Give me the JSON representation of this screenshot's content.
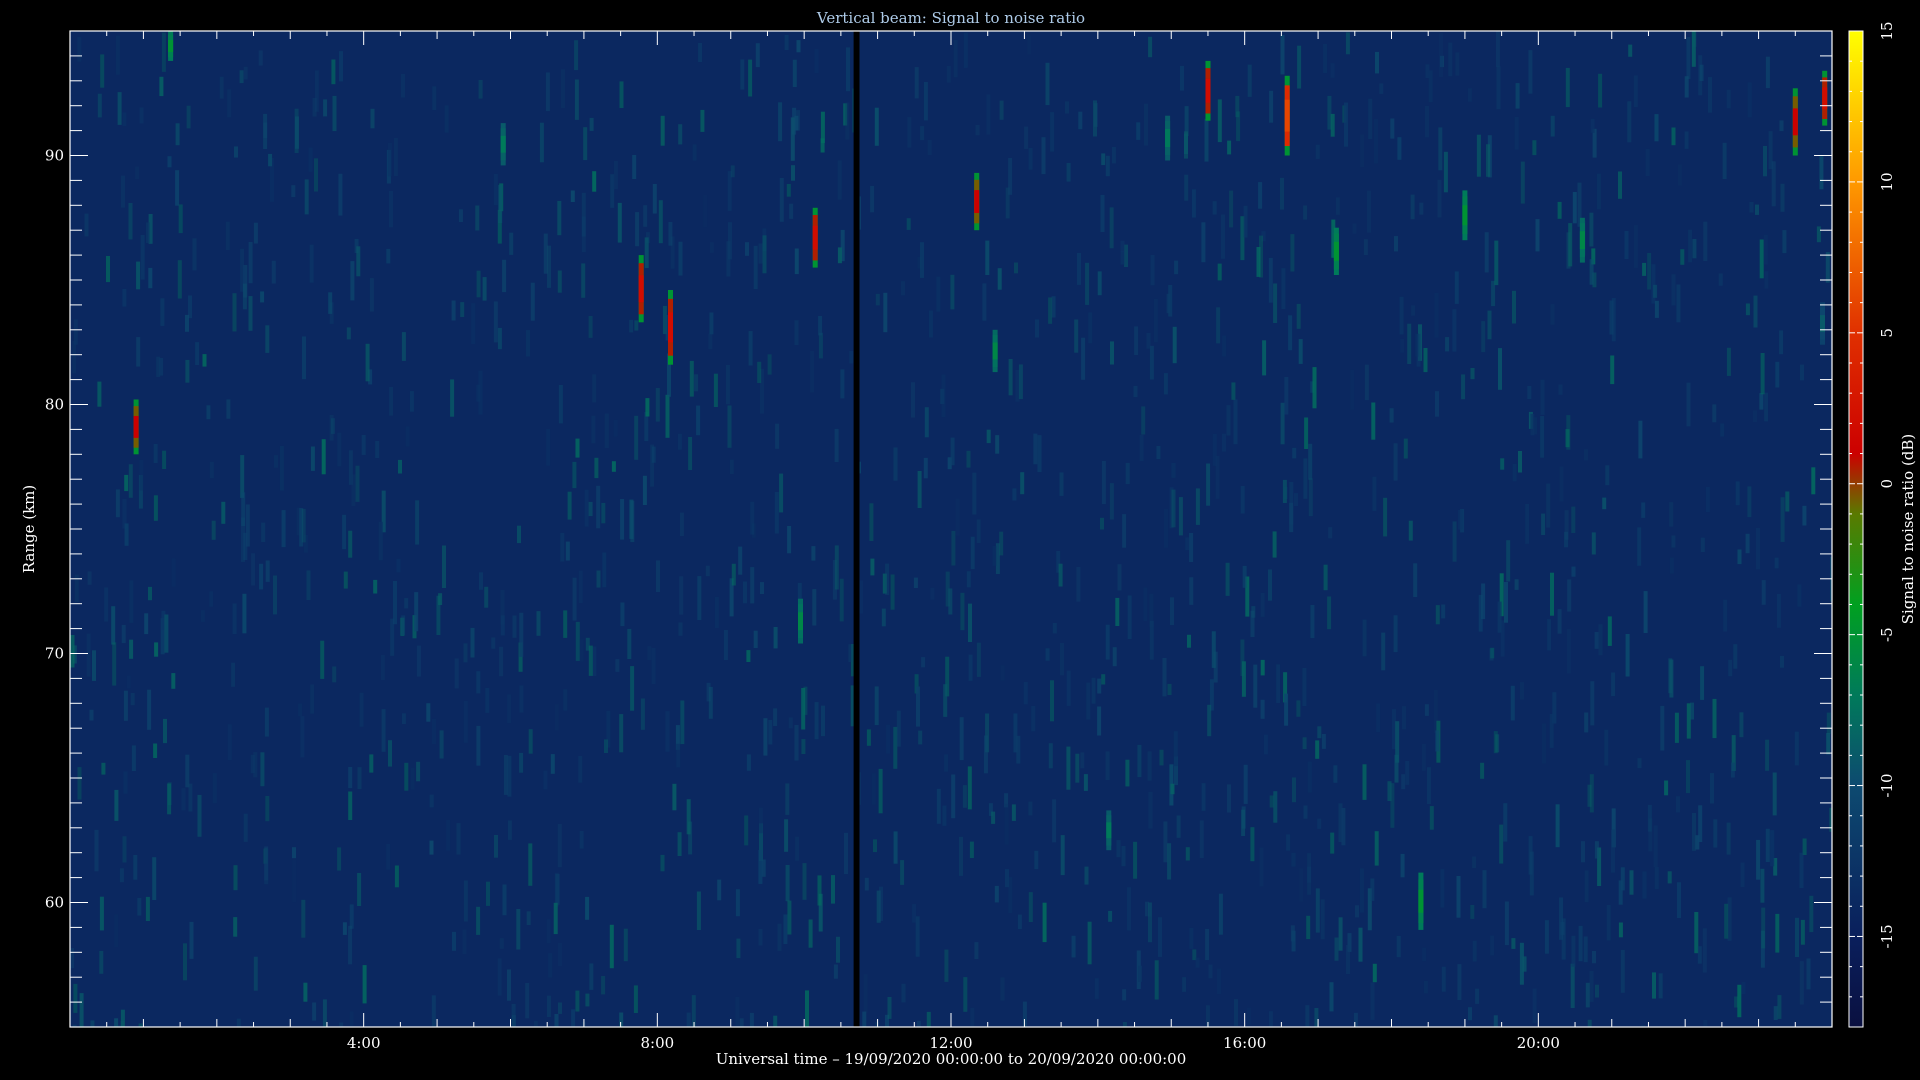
{
  "chart_data": {
    "type": "heatmap",
    "title": "Vertical beam: Signal to noise ratio",
    "xlabel": "Universal time – 19/09/2020 00:00:00 to 20/09/2020 00:00:00",
    "ylabel": "Range (km)",
    "colorbar_label": "Signal to noise ratio (dB)",
    "x_unit": "hours UT",
    "xlim": [
      0,
      24
    ],
    "ylim": [
      55,
      95
    ],
    "clim": [
      -18,
      15
    ],
    "x_ticks": [
      {
        "value": 4,
        "label": "4:00"
      },
      {
        "value": 8,
        "label": "8:00"
      },
      {
        "value": 12,
        "label": "12:00"
      },
      {
        "value": 16,
        "label": "16:00"
      },
      {
        "value": 20,
        "label": "20:00"
      }
    ],
    "y_ticks": [
      {
        "value": 60,
        "label": "60"
      },
      {
        "value": 70,
        "label": "70"
      },
      {
        "value": 80,
        "label": "80"
      },
      {
        "value": 90,
        "label": "90"
      }
    ],
    "colorbar_ticks": [
      {
        "value": 15,
        "label": "15"
      },
      {
        "value": 10,
        "label": "10"
      },
      {
        "value": 5,
        "label": "5"
      },
      {
        "value": 0,
        "label": "0"
      },
      {
        "value": -5,
        "label": "-5"
      },
      {
        "value": -10,
        "label": "-10"
      },
      {
        "value": -15,
        "label": "-15"
      }
    ],
    "colormap": [
      {
        "value": -18,
        "color": "#0a1040"
      },
      {
        "value": -15,
        "color": "#0a1f5c"
      },
      {
        "value": -10,
        "color": "#0d4a70"
      },
      {
        "value": -7,
        "color": "#007a5a"
      },
      {
        "value": -4,
        "color": "#00a020"
      },
      {
        "value": -1,
        "color": "#5a7a00"
      },
      {
        "value": 1,
        "color": "#cc0000"
      },
      {
        "value": 5,
        "color": "#e03000"
      },
      {
        "value": 10,
        "color": "#ff9900"
      },
      {
        "value": 15,
        "color": "#ffff00"
      }
    ],
    "background_snr": -14,
    "data_gap": {
      "x": 10.7,
      "width_hours": 0.08
    },
    "echoes": [
      {
        "x": 0.9,
        "y0": 78.0,
        "y1": 80.2,
        "snr": 1
      },
      {
        "x": 1.37,
        "y0": 93.8,
        "y1": 95.0,
        "snr": -5
      },
      {
        "x": 5.9,
        "y0": 89.6,
        "y1": 91.3,
        "snr": -7
      },
      {
        "x": 7.78,
        "y0": 83.3,
        "y1": 86.0,
        "snr": 2
      },
      {
        "x": 8.18,
        "y0": 81.6,
        "y1": 84.6,
        "snr": 2
      },
      {
        "x": 10.15,
        "y0": 85.5,
        "y1": 87.9,
        "snr": 2
      },
      {
        "x": 9.95,
        "y0": 70.4,
        "y1": 72.2,
        "snr": -6
      },
      {
        "x": 12.35,
        "y0": 87.0,
        "y1": 89.3,
        "snr": 1
      },
      {
        "x": 12.6,
        "y0": 81.3,
        "y1": 83.0,
        "snr": -6
      },
      {
        "x": 14.15,
        "y0": 62.1,
        "y1": 63.7,
        "snr": -7
      },
      {
        "x": 14.95,
        "y0": 89.8,
        "y1": 91.6,
        "snr": -7
      },
      {
        "x": 15.5,
        "y0": 91.4,
        "y1": 93.8,
        "snr": 2
      },
      {
        "x": 16.58,
        "y0": 90.0,
        "y1": 93.2,
        "snr": 6
      },
      {
        "x": 17.25,
        "y0": 85.2,
        "y1": 87.1,
        "snr": -5
      },
      {
        "x": 18.4,
        "y0": 58.9,
        "y1": 61.2,
        "snr": -5
      },
      {
        "x": 19.0,
        "y0": 86.6,
        "y1": 88.6,
        "snr": -5
      },
      {
        "x": 20.6,
        "y0": 85.7,
        "y1": 87.5,
        "snr": -6
      },
      {
        "x": 23.5,
        "y0": 90.0,
        "y1": 92.7,
        "snr": 1
      },
      {
        "x": 23.9,
        "y0": 91.2,
        "y1": 93.4,
        "snr": 2
      },
      {
        "x": 23.87,
        "y0": 82.4,
        "y1": 84.1,
        "snr": -9
      }
    ]
  }
}
